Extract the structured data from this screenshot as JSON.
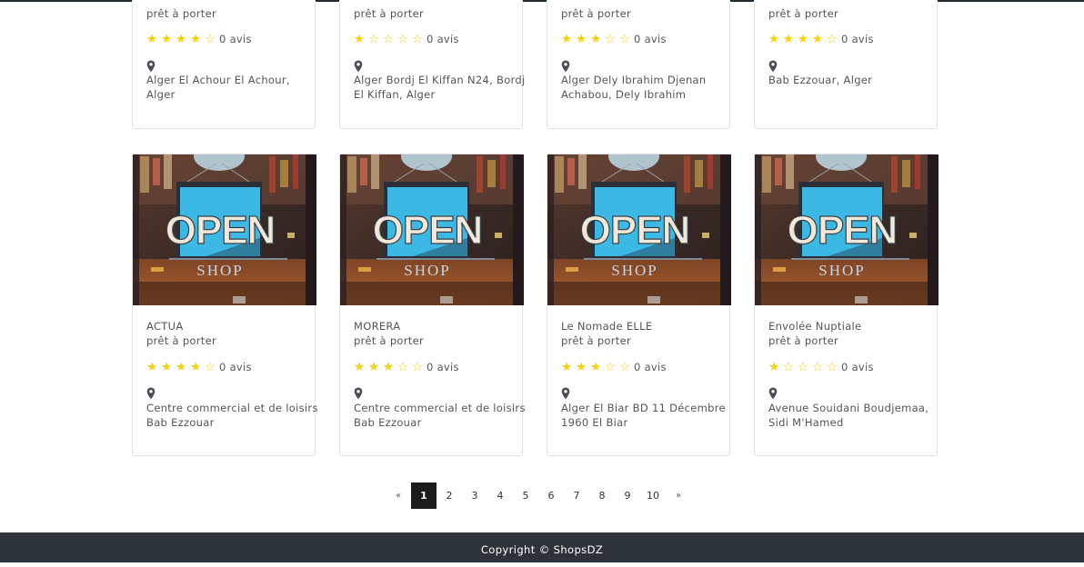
{
  "top_row": [
    {
      "category": "prêt à porter",
      "rating": 4,
      "reviews": "0 avis",
      "address": "Alger El Achour El Achour, Alger"
    },
    {
      "category": "prêt à porter",
      "rating": 1,
      "reviews": "0 avis",
      "address": "Alger Bordj El Kiffan N24, Bordj El Kiffan, Alger"
    },
    {
      "category": "prêt à porter",
      "rating": 3,
      "reviews": "0 avis",
      "address": "Alger Dely Ibrahim Djenan Achabou, Dely Ibrahim"
    },
    {
      "category": "prêt à porter",
      "rating": 4,
      "reviews": "0 avis",
      "address": "Bab Ezzouar, Alger"
    }
  ],
  "bottom_row": [
    {
      "name": "ACTUA",
      "category": "prêt à porter",
      "rating": 4,
      "reviews": "0 avis",
      "address": "Centre commercial et de loisirs Bab Ezzouar",
      "image": {
        "sign_text": "OPEN",
        "sub_text": "SHOP"
      }
    },
    {
      "name": "MORERA",
      "category": "prêt à porter",
      "rating": 3,
      "reviews": "0 avis",
      "address": "Centre commercial et de loisirs Bab Ezzouar",
      "image": {
        "sign_text": "OPEN",
        "sub_text": "SHOP"
      }
    },
    {
      "name": "Le Nomade ELLE",
      "category": "prêt à porter",
      "rating": 3,
      "reviews": "0 avis",
      "address": "Alger El Biar BD 11 Décembre 1960 El Biar",
      "image": {
        "sign_text": "OPEN",
        "sub_text": "SHOP"
      }
    },
    {
      "name": "Envolée Nuptiale",
      "category": "prêt à porter",
      "rating": 1,
      "reviews": "0 avis",
      "address": "Avenue Souidani Boudjemaa, Sidi M'Hamed",
      "image": {
        "sign_text": "OPEN",
        "sub_text": "SHOP"
      }
    }
  ],
  "icons": {
    "star_full": "star-filled-icon",
    "star_empty": "star-outline-icon",
    "location": "map-pin-icon"
  },
  "colors": {
    "star": "#f5d20c",
    "footer_bg": "#2e3239",
    "active_page_bg": "#1c1c1c"
  },
  "pagination": {
    "prev": "«",
    "next": "»",
    "pages": [
      "1",
      "2",
      "3",
      "4",
      "5",
      "6",
      "7",
      "8",
      "9",
      "10"
    ],
    "active": "1"
  },
  "footer": {
    "copyright": "Copyright © ShopsDZ"
  }
}
